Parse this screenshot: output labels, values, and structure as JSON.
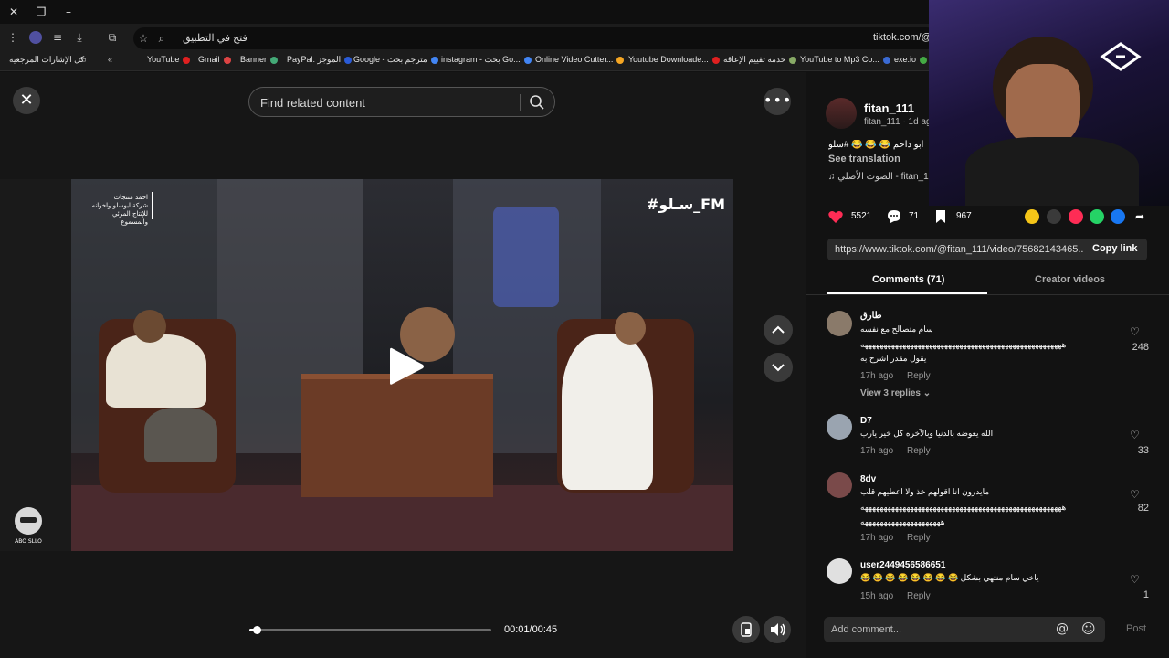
{
  "browser": {
    "omnibox_open_in_app": "فتح في التطبيق",
    "url_host": "tiktok.com/@fi",
    "bookmarks": [
      {
        "label": "كل الإشارات المرجعية"
      },
      {
        "label": "YouTube"
      },
      {
        "label": "Gmail"
      },
      {
        "label": "Banner"
      },
      {
        "label": "PayPal: الموجز"
      },
      {
        "label": "Google - مترجم بحث"
      },
      {
        "label": "instagram - بحث Go..."
      },
      {
        "label": "Online Video Cutter..."
      },
      {
        "label": "Youtube Downloade..."
      },
      {
        "label": "خدمة تقييم الإعاقة"
      },
      {
        "label": "YouTube to Mp3 Co..."
      },
      {
        "label": "exe.io"
      }
    ]
  },
  "player": {
    "search_placeholder": "Find related content",
    "overlay_hashtag": "#سـلو_FM",
    "overlay_credit": "احمد منتجات\nشركة ابوسلو واخوانه\nللإنتاج المرئي والمسموع",
    "badge_text": "ABO SLLO",
    "time": "00:01/00:45",
    "progress": 0.022
  },
  "post": {
    "username": "fitan_111",
    "userline": "fitan_111 · 1d ag",
    "caption": "ابو داحم 😂 😂 😂 #سلو",
    "see_translation": "See translation",
    "sound": "الصوت الأصلي - fitan_1",
    "likes": "5521",
    "comments": "71",
    "saves": "967",
    "url": "https://www.tiktok.com/@fitan_111/video/75682143465...",
    "copy_link": "Copy link",
    "tabs": [
      "Comments (71)",
      "Creator videos"
    ]
  },
  "comments": [
    {
      "user": "طارق",
      "lines": [
        "سام متصالح مع نفسه",
        "هههههههههههههههههههههههههههههههههههههههههههههههههههههه",
        "يقول مقدر اشرح به"
      ],
      "meta": "17h ago",
      "reply": "Reply",
      "likes": "248",
      "view_replies": "View 3 replies"
    },
    {
      "user": "D7",
      "lines": [
        "الله يعوضه بالدنيا وبالآخره كل خير يارب"
      ],
      "meta": "17h ago",
      "reply": "Reply",
      "likes": "33"
    },
    {
      "user": "8dv",
      "lines": [
        "مايدرون انا اقولهم خذ ولا اعطيهم قلب",
        "هههههههههههههههههههههههههههههههههههههههههههههههههههههه",
        "هههههههههههههههههههههه"
      ],
      "meta": "17h ago",
      "reply": "Reply",
      "likes": "82"
    },
    {
      "user": "user2449456586651",
      "lines": [
        "ياخي سام منتهي بشكل 😂 😂 😂 😂 😂 😂 😂 😂"
      ],
      "meta": "15h ago",
      "reply": "Reply",
      "likes": "1"
    }
  ],
  "composer": {
    "placeholder": "Add comment...",
    "post_label": "Post"
  },
  "colors": {
    "like_pink": "#fe2c55",
    "accent_white": "#ffffff"
  }
}
